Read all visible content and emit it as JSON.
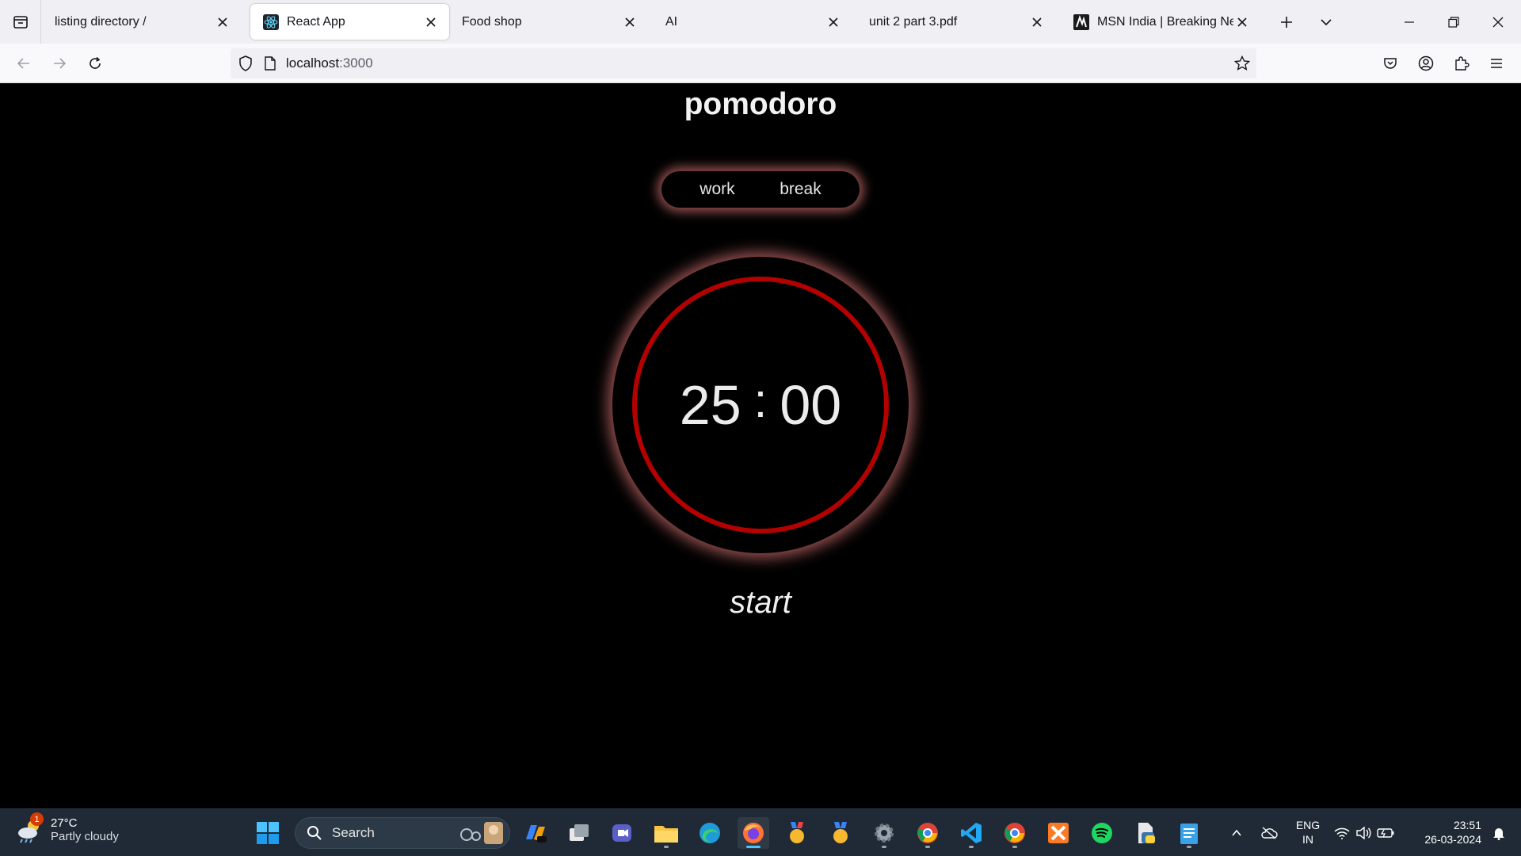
{
  "browser": {
    "tabs": [
      {
        "title": "listing directory /",
        "active": false
      },
      {
        "title": "React App",
        "active": true
      },
      {
        "title": "Food shop",
        "active": false
      },
      {
        "title": "AI",
        "active": false
      },
      {
        "title": "unit 2 part 3.pdf",
        "active": false
      },
      {
        "title": "MSN India | Breaking News,",
        "active": false
      }
    ],
    "url_host": "localhost",
    "url_port": ":3000"
  },
  "app": {
    "title": "pomodoro",
    "modes": [
      "work",
      "break"
    ],
    "timer": {
      "minutes": "25",
      "separator": ":",
      "seconds": "00"
    },
    "start_label": "start",
    "colors": {
      "ring": "#b30000",
      "glow": "#cd6e6e",
      "background": "#000000"
    }
  },
  "taskbar": {
    "weather": {
      "temp": "27°C",
      "condition": "Partly cloudy",
      "badge": "1"
    },
    "search_placeholder": "Search",
    "language": {
      "line1": "ENG",
      "line2": "IN"
    },
    "clock": {
      "time": "23:51",
      "date": "26-03-2024"
    }
  }
}
